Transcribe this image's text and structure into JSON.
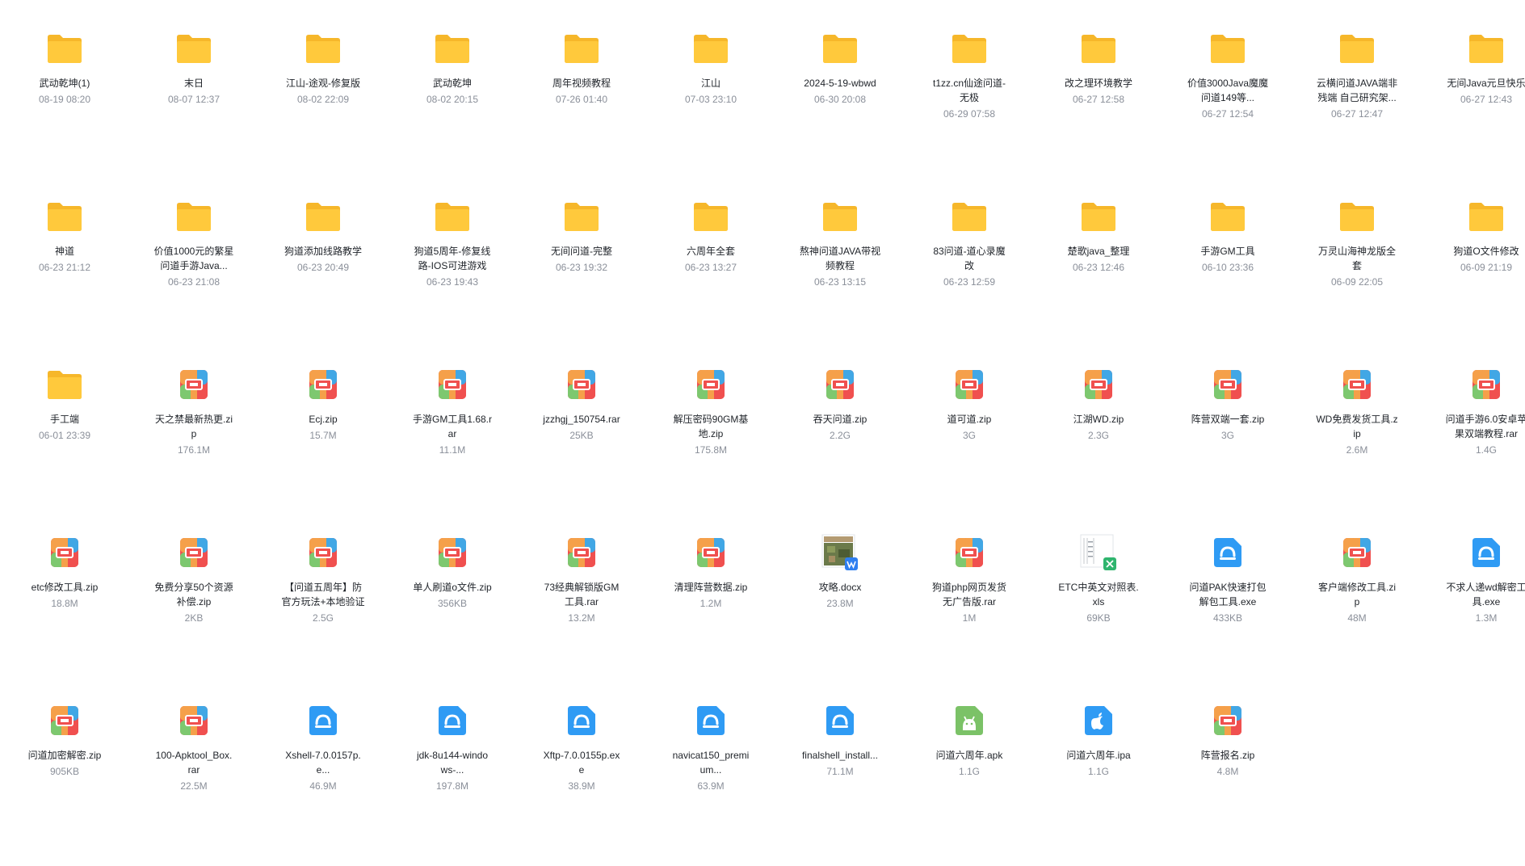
{
  "colors": {
    "folder": "#FFC93C",
    "archive_red": "#F0504F",
    "archive_orange": "#F5A04A",
    "archive_green": "#7DC86F",
    "archive_blue": "#41A7E5",
    "exe_blue": "#2F9BF4",
    "apk_green": "#7BC267",
    "ipa_blue": "#2F9BF4",
    "text_primary": "#1f2329",
    "text_secondary": "#8a8f99"
  },
  "files": [
    {
      "type": "folder",
      "name": "武动乾坤(1)",
      "meta": "08-19 08:20"
    },
    {
      "type": "folder",
      "name": "末日",
      "meta": "08-07 12:37"
    },
    {
      "type": "folder",
      "name": "江山-途观-修复版",
      "meta": "08-02 22:09"
    },
    {
      "type": "folder",
      "name": "武动乾坤",
      "meta": "08-02 20:15"
    },
    {
      "type": "folder",
      "name": "周年视频教程",
      "meta": "07-26 01:40"
    },
    {
      "type": "folder",
      "name": "江山",
      "meta": "07-03 23:10"
    },
    {
      "type": "folder",
      "name": "2024-5-19-wbwd",
      "meta": "06-30 20:08"
    },
    {
      "type": "folder",
      "name": "t1zz.cn仙途问道-\n无极",
      "meta": "06-29 07:58"
    },
    {
      "type": "folder",
      "name": "改之理环境教学",
      "meta": "06-27 12:58"
    },
    {
      "type": "folder",
      "name": "价值3000Java魔魔\n问道149等...",
      "meta": "06-27 12:54"
    },
    {
      "type": "folder",
      "name": "云横问道JAVA端非\n残端 自己研究架...",
      "meta": "06-27 12:47"
    },
    {
      "type": "folder",
      "name": "无间Java元旦快乐",
      "meta": "06-27 12:43"
    },
    {
      "type": "folder",
      "name": "神道",
      "meta": "06-23 21:12"
    },
    {
      "type": "folder",
      "name": "价值1000元的繁星\n问道手游Java...",
      "meta": "06-23 21:08"
    },
    {
      "type": "folder",
      "name": "狗道添加线路教学",
      "meta": "06-23 20:49"
    },
    {
      "type": "folder",
      "name": "狗道5周年-修复线\n路-IOS可进游戏",
      "meta": "06-23 19:43"
    },
    {
      "type": "folder",
      "name": "无间问道-完整",
      "meta": "06-23 19:32"
    },
    {
      "type": "folder",
      "name": "六周年全套",
      "meta": "06-23 13:27"
    },
    {
      "type": "folder",
      "name": "熬神问道JAVA带视\n频教程",
      "meta": "06-23 13:15"
    },
    {
      "type": "folder",
      "name": "83问道-道心录魔\n改",
      "meta": "06-23 12:59"
    },
    {
      "type": "folder",
      "name": "楚歌java_整理",
      "meta": "06-23 12:46"
    },
    {
      "type": "folder",
      "name": "手游GM工具",
      "meta": "06-10 23:36"
    },
    {
      "type": "folder",
      "name": "万灵山海神龙版全\n套",
      "meta": "06-09 22:05"
    },
    {
      "type": "folder",
      "name": "狗道O文件修改",
      "meta": "06-09 21:19"
    },
    {
      "type": "folder",
      "name": "手工端",
      "meta": "06-01 23:39"
    },
    {
      "type": "archive",
      "name": "天之禁最新热更.zi\np",
      "meta": "176.1M"
    },
    {
      "type": "archive",
      "name": "Ecj.zip",
      "meta": "15.7M"
    },
    {
      "type": "archive",
      "name": "手游GM工具1.68.r\nar",
      "meta": "11.1M"
    },
    {
      "type": "archive",
      "name": "jzzhgj_150754.rar",
      "meta": "25KB"
    },
    {
      "type": "archive",
      "name": "解压密码90GM基\n地.zip",
      "meta": "175.8M"
    },
    {
      "type": "archive",
      "name": "吞天问道.zip",
      "meta": "2.2G"
    },
    {
      "type": "archive",
      "name": "道可道.zip",
      "meta": "3G"
    },
    {
      "type": "archive",
      "name": "江湖WD.zip",
      "meta": "2.3G"
    },
    {
      "type": "archive",
      "name": "阵营双端一套.zip",
      "meta": "3G"
    },
    {
      "type": "archive",
      "name": "WD免费发货工具.z\nip",
      "meta": "2.6M"
    },
    {
      "type": "archive",
      "name": "问道手游6.0安卓苹\n果双端教程.rar",
      "meta": "1.4G"
    },
    {
      "type": "archive",
      "name": "etc修改工具.zip",
      "meta": "18.8M"
    },
    {
      "type": "archive",
      "name": "免费分享50个资源\n补偿.zip",
      "meta": "2KB"
    },
    {
      "type": "archive",
      "name": "【问道五周年】防\n官方玩法+本地验证",
      "meta": "2.5G"
    },
    {
      "type": "archive",
      "name": "单人刷道o文件.zip",
      "meta": "356KB"
    },
    {
      "type": "archive",
      "name": "73经典解锁版GM\n工具.rar",
      "meta": "13.2M"
    },
    {
      "type": "archive",
      "name": "清理阵营数据.zip",
      "meta": "1.2M"
    },
    {
      "type": "docx",
      "name": "攻略.docx",
      "meta": "23.8M"
    },
    {
      "type": "archive",
      "name": "狗道php网页发货\n无广告版.rar",
      "meta": "1M"
    },
    {
      "type": "xls",
      "name": "ETC中英文对照表.\nxls",
      "meta": "69KB"
    },
    {
      "type": "exe",
      "name": "问道PAK快速打包\n解包工具.exe",
      "meta": "433KB"
    },
    {
      "type": "archive",
      "name": "客户端修改工具.zi\np",
      "meta": "48M"
    },
    {
      "type": "exe",
      "name": "不求人递wd解密工\n具.exe",
      "meta": "1.3M"
    },
    {
      "type": "archive",
      "name": "问道加密解密.zip",
      "meta": "905KB"
    },
    {
      "type": "archive",
      "name": "100-Apktool_Box.\nrar",
      "meta": "22.5M"
    },
    {
      "type": "exe",
      "name": "Xshell-7.0.0157p.\ne...",
      "meta": "46.9M"
    },
    {
      "type": "exe",
      "name": "jdk-8u144-windo\nws-...",
      "meta": "197.8M"
    },
    {
      "type": "exe",
      "name": "Xftp-7.0.0155p.ex\ne",
      "meta": "38.9M"
    },
    {
      "type": "exe",
      "name": "navicat150_premi\num...",
      "meta": "63.9M"
    },
    {
      "type": "exe",
      "name": "finalshell_install...",
      "meta": "71.1M"
    },
    {
      "type": "apk",
      "name": "问道六周年.apk",
      "meta": "1.1G"
    },
    {
      "type": "ipa",
      "name": "问道六周年.ipa",
      "meta": "1.1G"
    },
    {
      "type": "archive",
      "name": "阵营报名.zip",
      "meta": "4.8M"
    }
  ]
}
